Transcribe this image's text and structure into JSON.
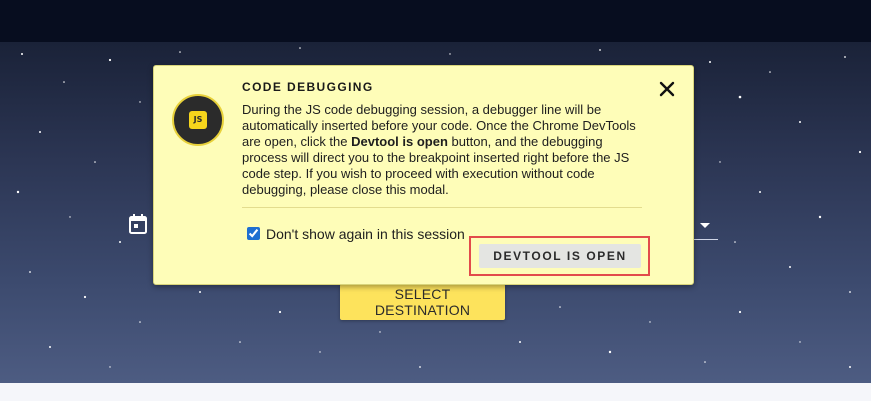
{
  "background_page": {
    "primary_action_label": "SELECT DESTINATION"
  },
  "modal": {
    "title": "CODE DEBUGGING",
    "badge_text": "JS",
    "body_pre": "During the JS code debugging session, a debugger line will be automatically inserted before your code. Once the Chrome DevTools are open, click the ",
    "body_bold": "Devtool is open",
    "body_post": " button, and the debugging process will direct you to the breakpoint inserted right before the JS code step. If you wish to proceed with execution without code debugging, please close this modal.",
    "checkbox_label": "Don't show again in this session",
    "checkbox_checked": true,
    "confirm_button_label": "DEVTOOL IS OPEN"
  },
  "icons": {
    "close": "close-icon",
    "calendar": "calendar-icon",
    "dropdown": "chevron-down-icon"
  },
  "colors": {
    "modal_bg": "#fefdb8",
    "accent_yellow": "#fde35c",
    "highlight_red": "#e24b4b"
  }
}
